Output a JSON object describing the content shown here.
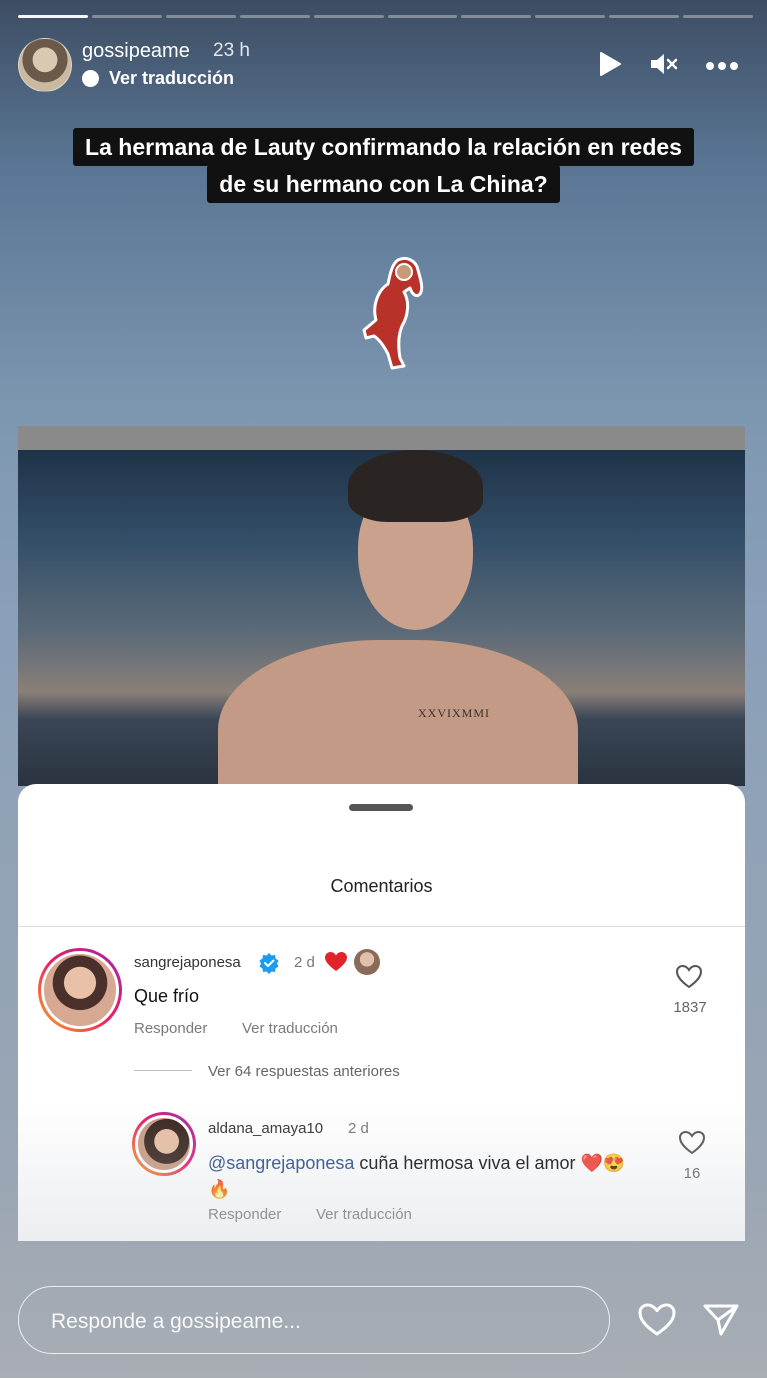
{
  "story": {
    "progress_segments": 10,
    "active_segment": 1,
    "username": "gossipeame",
    "time": "23 h",
    "translate_label": "Ver traducción",
    "controls": {
      "play_icon": "play-icon",
      "mute_icon": "mute-icon",
      "more_icon": "more-icon"
    }
  },
  "caption": {
    "line1": "La hermana de Lauty confirmando la relación en redes",
    "line2": "de su hermano con La China?"
  },
  "post": {
    "tattoo_text": "XXVIXMMI"
  },
  "comments_sheet": {
    "title": "Comentarios",
    "comments": [
      {
        "username": "sangrejaponesa",
        "time": "2 d",
        "text": "Que frío",
        "reply_label": "Responder",
        "translate_label": "Ver traducción",
        "likes": "1837"
      }
    ],
    "view_replies": "Ver 64 respuestas anteriores",
    "reply": {
      "username": "aldana_amaya10",
      "time": "2 d",
      "mention": "@sangrejaponesa",
      "text": " cuña hermosa viva el amor ❤️😍",
      "text_line2": "🔥",
      "reply_label": "Responder",
      "translate_label": "Ver traducción",
      "likes": "16"
    }
  },
  "footer": {
    "reply_placeholder": "Responde a gossipeame...",
    "like_icon": "heart-icon",
    "share_icon": "send-icon"
  },
  "colors": {
    "verified": "#1d9bf0",
    "heart": "#e0242c",
    "ring_start": "#f9a825",
    "ring_end": "#9c27b0"
  }
}
